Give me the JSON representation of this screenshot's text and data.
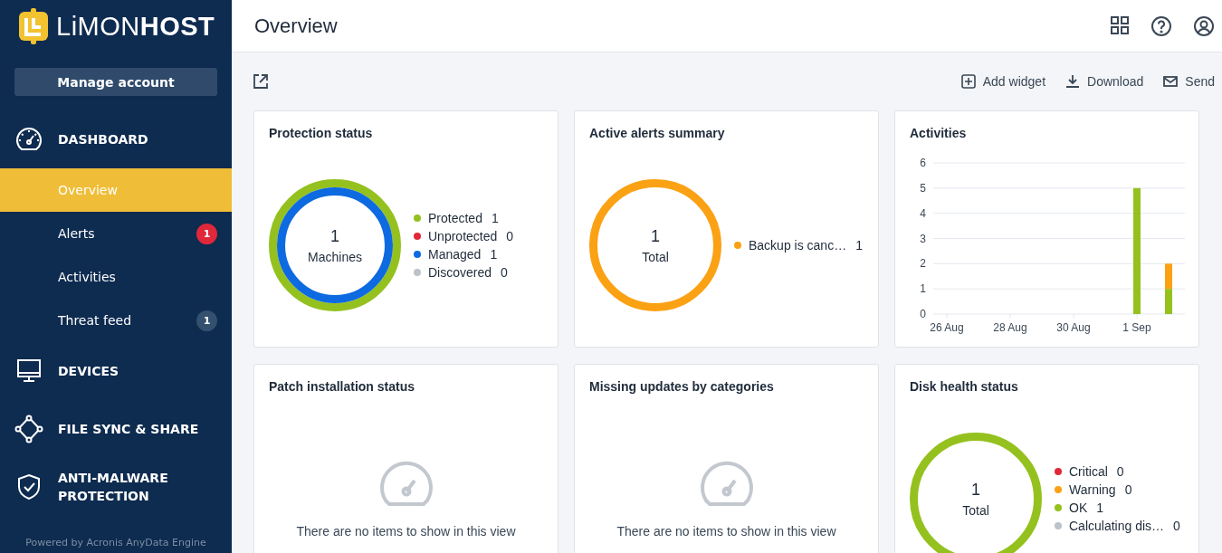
{
  "brand": {
    "light": "LiMON",
    "bold": "HOST"
  },
  "manage_account": "Manage account",
  "nav": [
    {
      "label": "DASHBOARD",
      "children": [
        {
          "label": "Overview",
          "selected": true
        },
        {
          "label": "Alerts",
          "selected": false,
          "badge": {
            "text": "1",
            "color": "#e0283a"
          }
        },
        {
          "label": "Activities",
          "selected": false
        },
        {
          "label": "Threat feed",
          "selected": false,
          "badge": {
            "text": "1",
            "color": "#34506f"
          }
        }
      ]
    },
    {
      "label": "DEVICES"
    },
    {
      "label": "FILE SYNC & SHARE"
    },
    {
      "label": "ANTI-MALWARE PROTECTION"
    }
  ],
  "footer": "Powered by Acronis AnyData Engine",
  "header": {
    "title": "Overview"
  },
  "toolbar": [
    "Add widget",
    "Download",
    "Send"
  ],
  "widgets": [
    {
      "kind": "donut",
      "title": "Protection status",
      "center_value": "1",
      "center_label": "Machines",
      "legend": [
        {
          "label": "Protected",
          "value": "1",
          "color": "#95c11f"
        },
        {
          "label": "Unprotected",
          "value": "0",
          "color": "#e0283a"
        },
        {
          "label": "Managed",
          "value": "1",
          "color": "#0d6ae0"
        },
        {
          "label": "Discovered",
          "value": "0",
          "color": "#bcc2c9"
        }
      ]
    },
    {
      "kind": "donut",
      "title": "Active alerts summary",
      "center_value": "1",
      "center_label": "Total",
      "legend": [
        {
          "label": "Backup is canc…",
          "value": "1",
          "color": "#fba114"
        }
      ]
    },
    {
      "kind": "bar",
      "title": "Activities",
      "chart_data": {
        "type": "bar",
        "stacked": true,
        "grid": true,
        "categories": [
          "26 Aug",
          null,
          "28 Aug",
          null,
          "30 Aug",
          null,
          "1 Sep",
          null
        ],
        "yticks": [
          0,
          1,
          2,
          3,
          4,
          5,
          6
        ],
        "ylim": [
          0,
          6
        ],
        "series": [
          {
            "color": "#95c11f",
            "values": [
              0,
              0,
              0,
              0,
              0,
              0,
              5,
              1
            ]
          },
          {
            "color": "#fba114",
            "values": [
              0,
              0,
              0,
              0,
              0,
              0,
              0,
              1
            ]
          }
        ]
      }
    },
    {
      "kind": "empty",
      "title": "Patch installation status",
      "message": "There are no items to show in this view"
    },
    {
      "kind": "empty",
      "title": "Missing updates by categories",
      "message": "There are no items to show in this view"
    },
    {
      "kind": "donut",
      "title": "Disk health status",
      "center_value": "1",
      "center_label": "Total",
      "legend": [
        {
          "label": "Critical",
          "value": "0",
          "color": "#e0283a"
        },
        {
          "label": "Warning",
          "value": "0",
          "color": "#fba114"
        },
        {
          "label": "OK",
          "value": "1",
          "color": "#95c11f"
        },
        {
          "label": "Calculating dis…",
          "value": "0",
          "color": "#bcc2c9"
        }
      ]
    }
  ]
}
